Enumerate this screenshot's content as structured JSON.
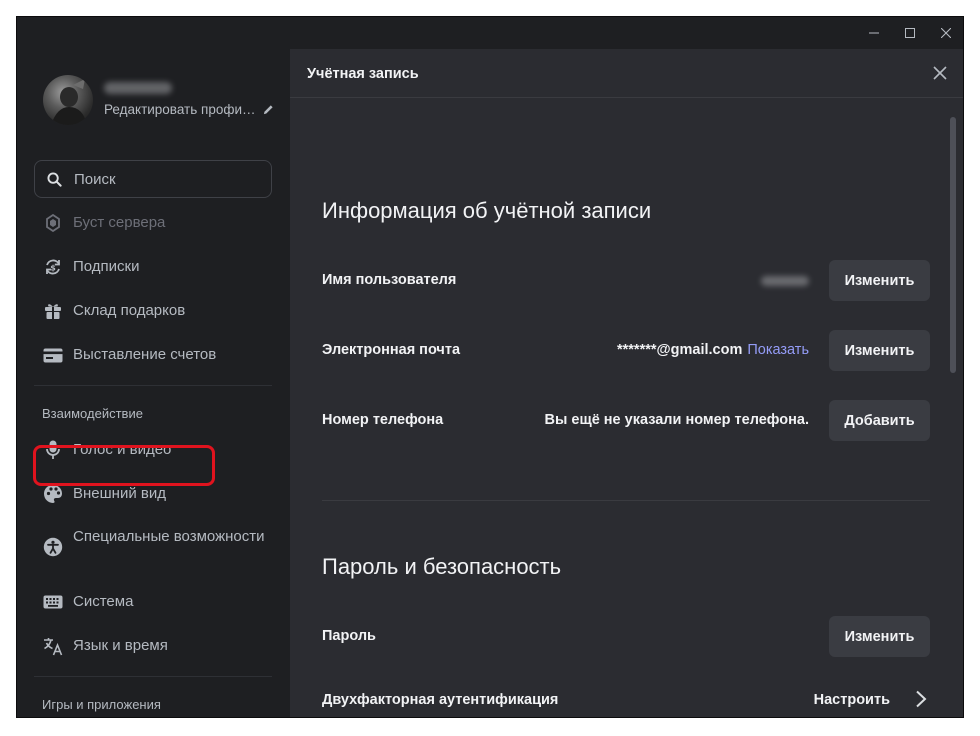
{
  "sidebar": {
    "profile": {
      "edit_label": "Редактировать профи…"
    },
    "search_placeholder": "Поиск",
    "items_top": [
      {
        "label": "Буст сервера",
        "icon": "boost-icon"
      },
      {
        "label": "Подписки",
        "icon": "subscriptions-icon"
      },
      {
        "label": "Склад подарков",
        "icon": "gift-icon"
      },
      {
        "label": "Выставление счетов",
        "icon": "card-icon"
      }
    ],
    "section_interaction": "Взаимодействие",
    "items_interaction": [
      {
        "label": "Голос и видео",
        "icon": "microphone-icon"
      },
      {
        "label": "Внешний вид",
        "icon": "palette-icon"
      },
      {
        "label": "Специальные возможности",
        "icon": "accessibility-icon"
      },
      {
        "label": "Система",
        "icon": "keyboard-icon"
      },
      {
        "label": "Язык и время",
        "icon": "translate-icon"
      }
    ],
    "section_games": "Игры и приложения"
  },
  "content": {
    "header_title": "Учётная запись",
    "account_info": {
      "heading": "Информация об учётной записи",
      "username_label": "Имя пользователя",
      "username_button": "Изменить",
      "email_label": "Электронная почта",
      "email_value": "*******@gmail.com",
      "email_show": "Показать",
      "email_button": "Изменить",
      "phone_label": "Номер телефона",
      "phone_value": "Вы ещё не указали номер телефона.",
      "phone_button": "Добавить"
    },
    "security": {
      "heading": "Пароль и безопасность",
      "password_label": "Пароль",
      "password_button": "Изменить",
      "twofa_label": "Двухфакторная аутентификация",
      "twofa_action": "Настроить"
    }
  },
  "colors": {
    "sidebar_bg": "#1e1f22",
    "content_bg": "#2b2c31",
    "button_bg": "#3a3c42",
    "link": "#949cf7",
    "highlight": "#e0131e"
  }
}
